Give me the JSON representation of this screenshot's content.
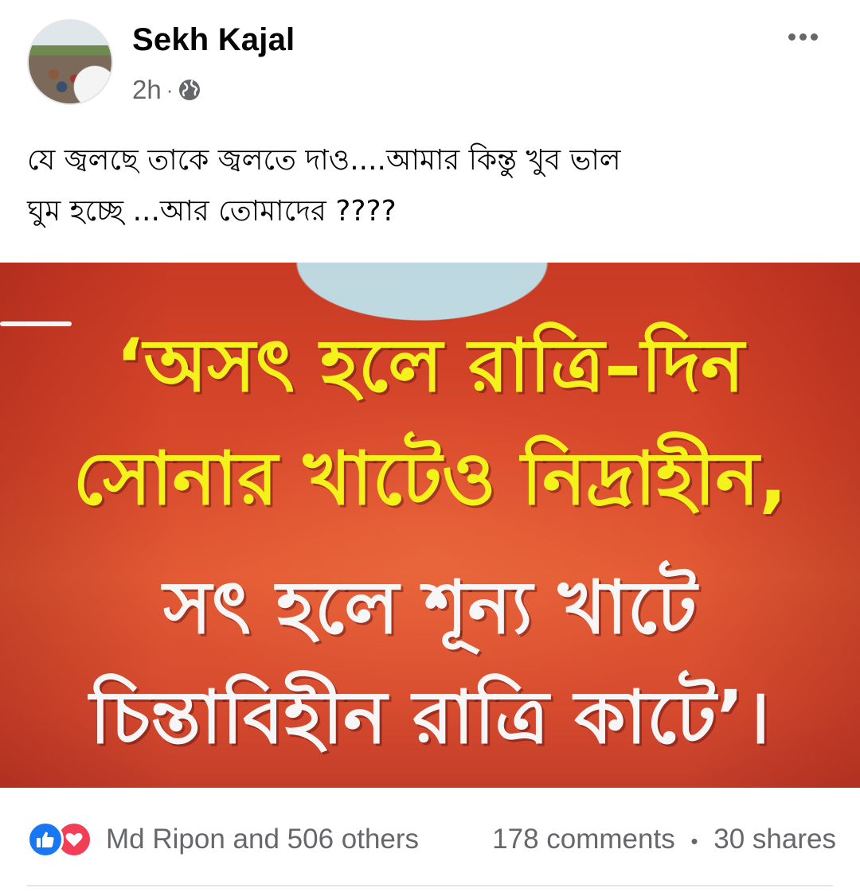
{
  "post": {
    "author": "Sekh Kajal",
    "time": "2h",
    "dot": "·",
    "privacy_icon": "globe-icon",
    "more_icon": "more-horizontal-icon",
    "text_line_1": "যে জ্বলছে তাকে জ্বলতে দাও....আমার কিন্তু খুব ভাল",
    "text_line_2": "ঘুম হচ্ছে ...আর তোমাদের ????"
  },
  "image": {
    "line_1": "‘অসৎ হলে রাত্রি–দিন",
    "line_2": "সোনার খাটেও নিদ্রাহীন,",
    "line_3": "সৎ হলে শূন্য খাটে",
    "line_4": "চিন্তাবিহীন রাত্রি কাটে’।",
    "colors": {
      "background": "#d8482b",
      "highlight_text": "#f4f21a",
      "plain_text": "#f6f6f6"
    }
  },
  "engagement": {
    "reaction_icons": [
      "like-icon",
      "love-icon"
    ],
    "reactors": "Md Ripon and 506 others",
    "comments": "178 comments",
    "separator": "•",
    "shares": "30 shares"
  },
  "colors": {
    "secondary_text": "#65676b",
    "like_blue": "#1877f2",
    "love_red": "#f33e58"
  }
}
